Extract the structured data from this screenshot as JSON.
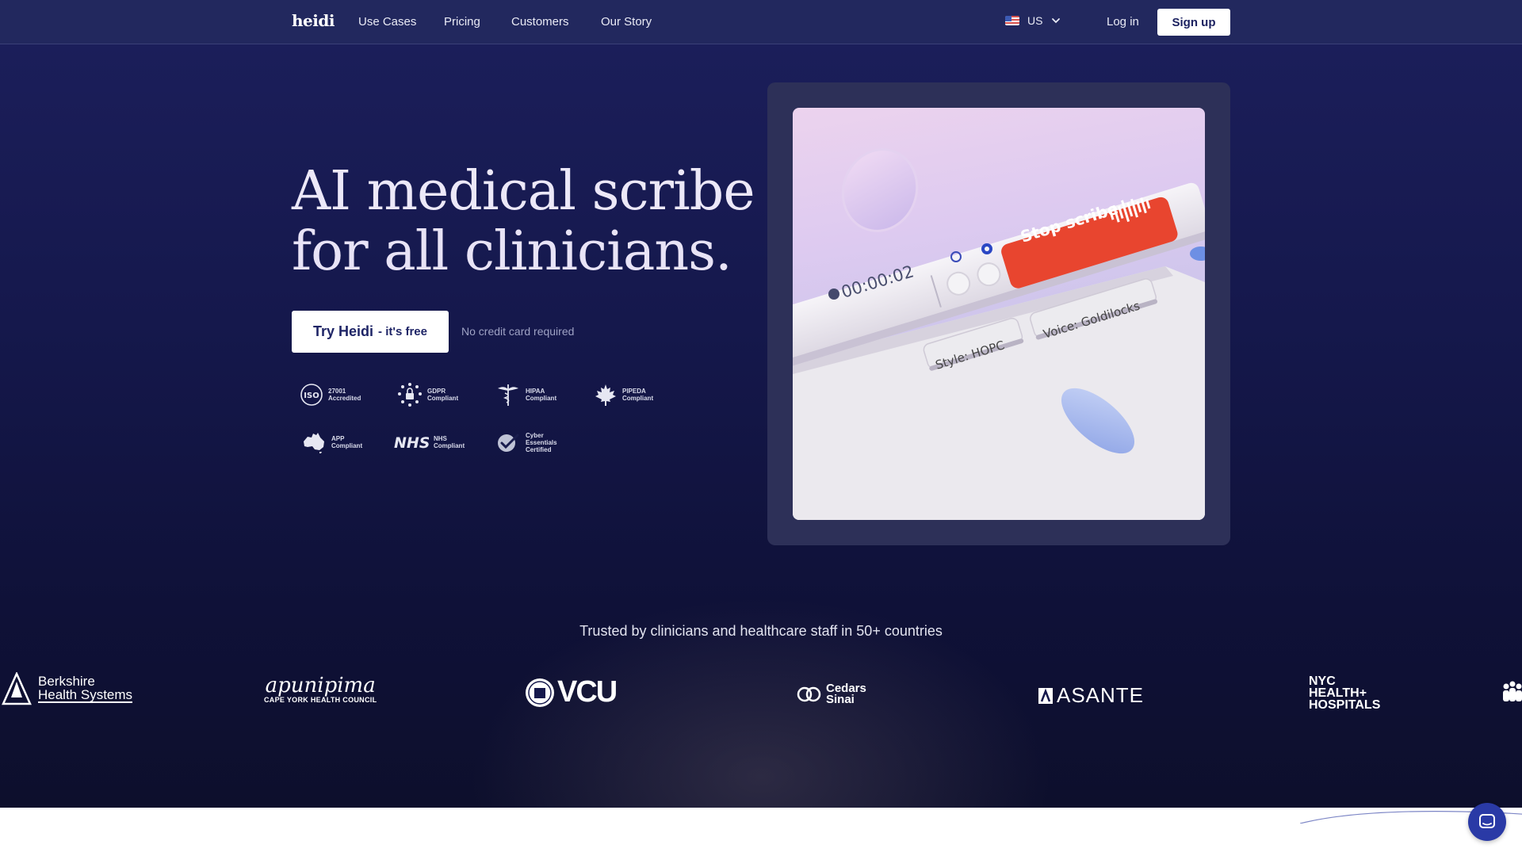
{
  "nav": {
    "logo": "heidi",
    "links": [
      "Use Cases",
      "Pricing",
      "Customers",
      "Our Story"
    ],
    "locale": "US",
    "login": "Log in",
    "signup": "Sign up"
  },
  "hero": {
    "headline_line1": "AI medical scribe",
    "headline_line2": "for all clinicians.",
    "cta_main": "Try Heidi",
    "cta_sub": "- it's free",
    "no_credit_card": "No credit card required"
  },
  "badges": [
    {
      "icon": "iso-icon",
      "line1": "27001",
      "line2": "Accredited"
    },
    {
      "icon": "gdpr-icon",
      "line1": "GDPR",
      "line2": "Compliant"
    },
    {
      "icon": "caduceus-icon",
      "line1": "HIPAA",
      "line2": "Compliant"
    },
    {
      "icon": "maple-leaf-icon",
      "line1": "PIPEDA",
      "line2": "Compliant"
    },
    {
      "icon": "australia-icon",
      "line1": "APP",
      "line2": "Compliant"
    },
    {
      "icon": "nhs-icon",
      "line1": "NHS",
      "line2": "Compliant"
    },
    {
      "icon": "cyber-essentials-icon",
      "line1": "Cyber",
      "line2": "Essentials",
      "line3": "Certified"
    }
  ],
  "hero_image": {
    "timer": "00:00:02",
    "stop_label": "Stop scribe",
    "style_label": "Style: HOPC",
    "voice_label": "Voice: Goldilocks"
  },
  "trusted": {
    "text": "Trusted by clinicians and healthcare staff in 50+ countries",
    "partners": {
      "berkshire_1": "Berkshire",
      "berkshire_2": "Health Systems",
      "apunipima_1": "apunipima",
      "apunipima_2": "CAPE YORK HEALTH COUNCIL",
      "vcu": "VCU",
      "cedars_1": "Cedars",
      "cedars_2": "Sinai",
      "asante": "ASANTE",
      "nyc_1": "NYC",
      "nyc_2": "HEALTH+",
      "nyc_3": "HOSPITALS"
    }
  },
  "colors": {
    "accent": "#1e2466",
    "stop_button": "#e8452f",
    "chat": "#2a3aa6"
  }
}
